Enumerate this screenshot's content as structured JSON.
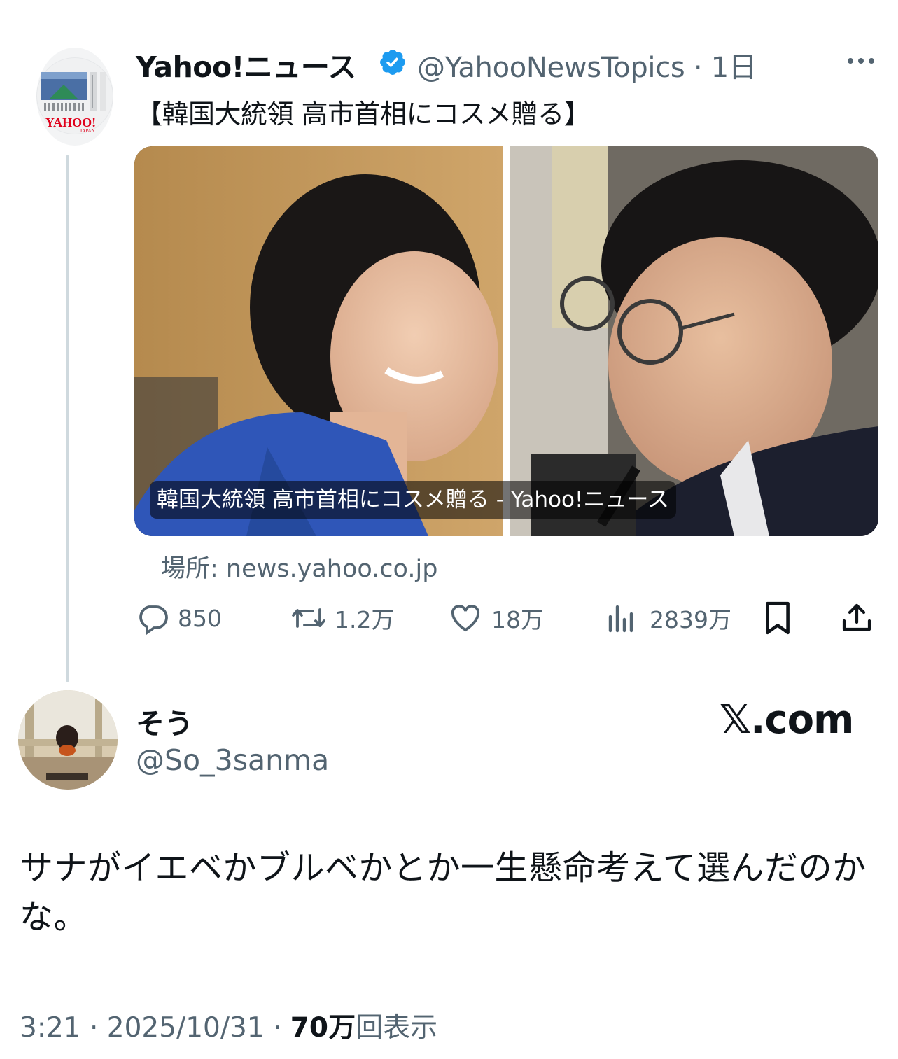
{
  "quoted_post": {
    "author_name": "Yahoo!ニュース",
    "author_handle": "@YahooNewsTopics",
    "time_ago": "1日",
    "avatar_logo_text": "YAHOO!",
    "avatar_logo_subtext": "JAPAN",
    "headline": "【韓国大統領 高市首相にコスメ贈る】",
    "card": {
      "caption": "韓国大統領 高市首相にコスメ贈る - Yahoo!ニュース",
      "source": "場所: news.yahoo.co.jp"
    },
    "actions": {
      "replies": "850",
      "reposts": "1.2万",
      "likes": "18万",
      "views": "2839万"
    }
  },
  "reply_post": {
    "author_name": "そう",
    "author_handle": "@So_3sanma",
    "body": "サナがイエベかブルベかとか一生懸命考えて選んだのかな。",
    "time": "3:21",
    "date": "2025/10/31",
    "views_count": "70万",
    "views_label": "回表示"
  },
  "watermark": "𝕏.com",
  "colors": {
    "text_primary": "#0f1419",
    "text_secondary": "#536471",
    "verified_blue": "#1d9bf0",
    "yahoo_red": "#e0001b",
    "thread_line": "#cfd9de"
  },
  "icons": [
    "verified-badge-icon",
    "more-icon",
    "reply-icon",
    "repost-icon",
    "like-icon",
    "views-icon",
    "bookmark-icon",
    "share-icon"
  ]
}
